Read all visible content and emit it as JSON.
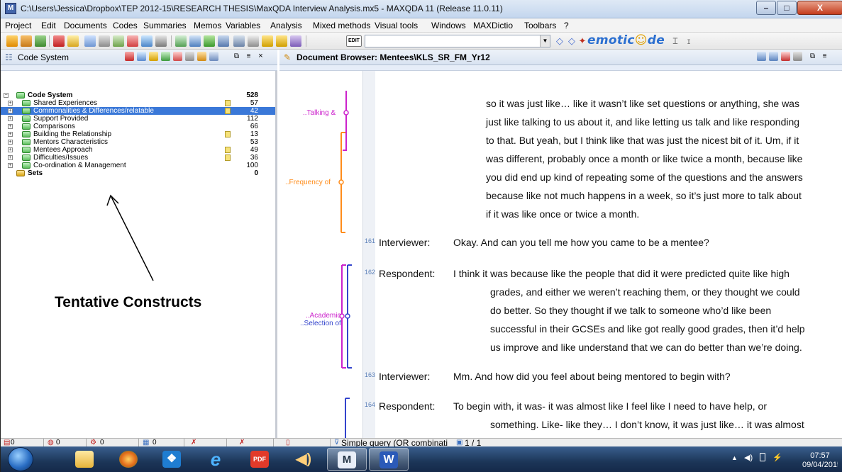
{
  "window": {
    "title": "C:\\Users\\Jessica\\Dropbox\\TEP 2012-15\\RESEARCH THESIS\\MaxQDA Interview Analysis.mx5 - MAXQDA 11 (Release 11.0.11)",
    "min": "–",
    "max": "□",
    "close": "X"
  },
  "menu": [
    {
      "label": "Project"
    },
    {
      "label": "Edit"
    },
    {
      "label": "Documents"
    },
    {
      "label": "Codes"
    },
    {
      "label": "Summaries"
    },
    {
      "label": "Memos"
    },
    {
      "label": "Variables"
    },
    {
      "label": "Analysis"
    },
    {
      "label": "Mixed methods"
    },
    {
      "label": "Visual tools"
    },
    {
      "label": "Windows"
    },
    {
      "label": "MAXDictio"
    },
    {
      "label": "Toolbars"
    },
    {
      "label": "?"
    }
  ],
  "toolbar": {
    "edit_badge": "EDIT",
    "search_value": "",
    "logo_a": "emotic",
    "logo_face": "☺",
    "logo_b": "de"
  },
  "code_system": {
    "title": "Code System",
    "root": {
      "label": "Code System",
      "count": "528"
    },
    "codes": [
      {
        "label": "Shared Experiences",
        "count": "57",
        "memo": true,
        "selected": false
      },
      {
        "label": "Commonalities & Differences/relatable",
        "count": "42",
        "memo": true,
        "selected": true
      },
      {
        "label": "Support Provided",
        "count": "112",
        "memo": false,
        "selected": false
      },
      {
        "label": "Comparisons",
        "count": "66",
        "memo": false,
        "selected": false
      },
      {
        "label": "Building the Relationship",
        "count": "13",
        "memo": true,
        "selected": false
      },
      {
        "label": "Mentors Characteristics",
        "count": "53",
        "memo": false,
        "selected": false
      },
      {
        "label": "Mentees Approach",
        "count": "49",
        "memo": true,
        "selected": false
      },
      {
        "label": "Difficulties/Issues",
        "count": "36",
        "memo": true,
        "selected": false
      },
      {
        "label": "Co-ordination & Management",
        "count": "100",
        "memo": false,
        "selected": false
      }
    ],
    "sets": {
      "label": "Sets",
      "count": "0"
    }
  },
  "annotation": "Tentative Constructs",
  "document_browser": {
    "title": "Document Browser: Mentees\\KLS_SR_FM_Yr12",
    "code_labels": [
      {
        "text": "..Talking &"
      },
      {
        "text": "..Frequency of"
      },
      {
        "text": "..Academic"
      },
      {
        "text": "..Selection of"
      }
    ],
    "lines": [
      {
        "num": "",
        "speaker": "",
        "text": "so it was just like… like it wasn’t like set questions or anything, she was"
      },
      {
        "num": "",
        "speaker": "",
        "text": "just like talking to us about it, and like letting us talk and like responding"
      },
      {
        "num": "",
        "speaker": "",
        "text": "to that. But yeah, but I think like that was just the nicest bit of it. Um, if it"
      },
      {
        "num": "",
        "speaker": "",
        "text": "was different, probably once a month or like twice a month, because like"
      },
      {
        "num": "",
        "speaker": "",
        "text": "you did end up kind of repeating some of the questions and the answers"
      },
      {
        "num": "",
        "speaker": "",
        "text": "because like not much happens in a week, so it’s just more to talk about"
      },
      {
        "num": "",
        "speaker": "",
        "text": "if it was like once or twice a month."
      },
      {
        "num": "161",
        "speaker": "Interviewer:",
        "text": "Okay. And can you tell me how you came to be a mentee?"
      },
      {
        "num": "162",
        "speaker": "Respondent:",
        "text": "I think it was because like the people that did it were predicted quite like high"
      },
      {
        "num": "",
        "speaker": "",
        "text": "grades, and either we weren’t reaching them, or they thought we could"
      },
      {
        "num": "",
        "speaker": "",
        "text": "do better. So they thought if we talk to someone who’d like been"
      },
      {
        "num": "",
        "speaker": "",
        "text": "successful in their GCSEs and like got really good grades, then it’d help"
      },
      {
        "num": "",
        "speaker": "",
        "text": "us improve and like understand that we can do better than we’re doing."
      },
      {
        "num": "163",
        "speaker": "Interviewer:",
        "text": "Mm. And how did you feel about being mentored to begin with?"
      },
      {
        "num": "164",
        "speaker": "Respondent:",
        "text": "To begin with, it was- it was almost like I feel like I need to have help, or"
      },
      {
        "num": "",
        "speaker": "",
        "text": "something. Like- like they… I don’t know, it was just like… it was almost"
      }
    ]
  },
  "statusbar": {
    "c1": "0",
    "c2": "0",
    "c3": "0",
    "c4": "0",
    "query": "Simple query (OR combinati",
    "pages": "1 / 1"
  },
  "taskbar": {
    "clock": "07:57",
    "date": "09/04/2015"
  },
  "colors": {
    "accent": "#3a78d8",
    "code_magenta": "#cc22cc",
    "code_orange": "#ff8c1a",
    "code_blue": "#3344cc",
    "code_purple": "#8a2be2"
  }
}
